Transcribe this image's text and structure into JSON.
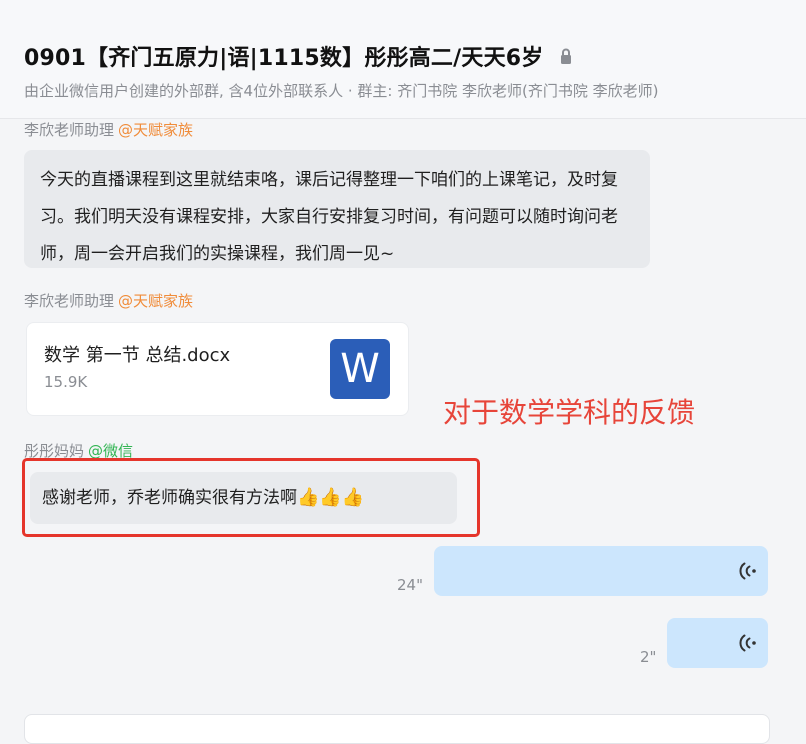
{
  "header": {
    "title": "0901【齐门五原力|语|1115数】彤彤高二/天天6岁",
    "subtitle": "由企业微信用户创建的外部群, 含4位外部联系人 · 群主: 齐门书院 李欣老师(齐门书院 李欣老师)"
  },
  "messages": [
    {
      "sender": "李欣老师助理",
      "tag": "@天赋家族",
      "text": "今天的直播课程到这里就结束咯，课后记得整理一下咱们的上课笔记，及时复习。我们明天没有课程安排，大家自行安排复习时间，有问题可以随时询问老师，周一会开启我们的实操课程，我们周一见~"
    },
    {
      "sender": "李欣老师助理",
      "tag": "@天赋家族",
      "file": {
        "name": "数学 第一节 总结.docx",
        "size": "15.9K",
        "icon_letter": "W"
      }
    },
    {
      "sender": "彤彤妈妈",
      "tag": "@微信",
      "text": "感谢老师，乔老师确实很有方法啊",
      "emoji": "👍👍👍"
    }
  ],
  "voice_messages": [
    {
      "duration": "24\""
    },
    {
      "duration": "2\""
    }
  ],
  "annotation": {
    "text": "对于数学学科的反馈",
    "color": "#e7453a"
  },
  "colors": {
    "bubble_in": "#e8eaed",
    "bubble_out": "#cce6fd",
    "tag_orange": "#f08c3a",
    "tag_green": "#33b554",
    "word_blue": "#2b5eb8"
  }
}
